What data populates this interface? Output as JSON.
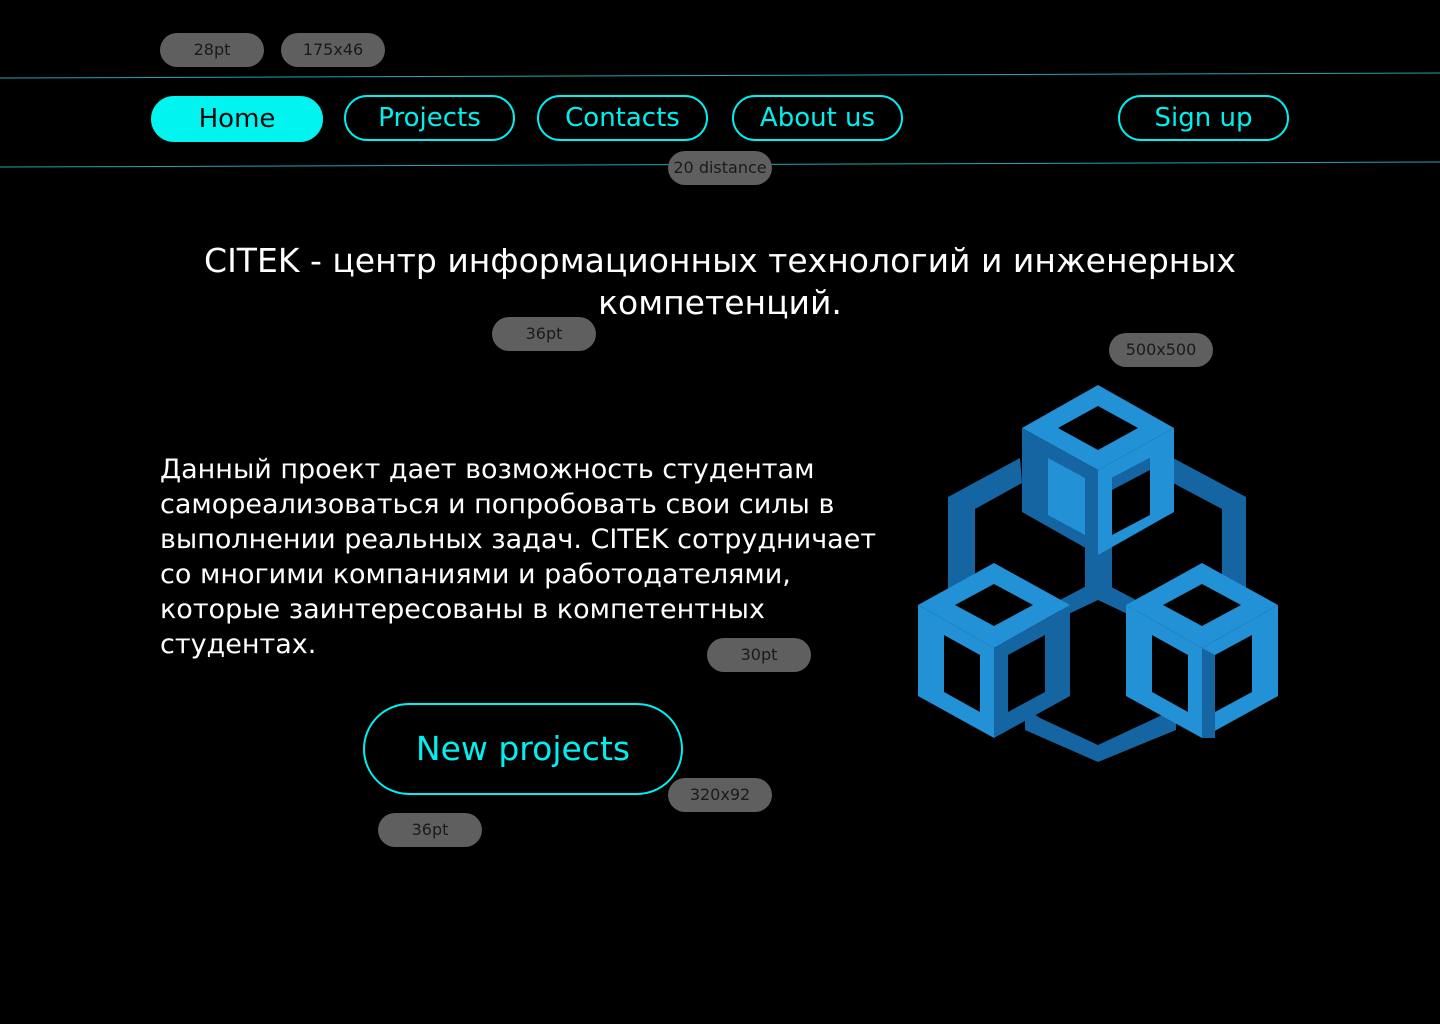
{
  "annotations": {
    "font_nav": "28pt",
    "size_nav": "175x46",
    "nav_gap": "20 distance",
    "font_heading": "36pt",
    "size_logo": "500x500",
    "font_desc": "30pt",
    "size_cta": "320x92",
    "font_cta": "36pt"
  },
  "nav": {
    "items": [
      {
        "label": "Home",
        "active": true
      },
      {
        "label": "Projects",
        "active": false
      },
      {
        "label": "Contacts",
        "active": false
      },
      {
        "label": "About us",
        "active": false
      }
    ],
    "signup_label": "Sign up"
  },
  "hero": {
    "heading": "CITEK - центр информационных технологий и инженерных компетенций.",
    "description": "Данный проект дает возможность студентам самореализоваться и попробовать свои силы в выполнении реальных задач. CITEK сотрудничает со многими компаниями и работодателями, которые заинтересованы в компетентных студентах.",
    "cta_label": "New projects"
  },
  "logo": {
    "icon": "three-cubes-logo-icon"
  },
  "colors": {
    "background": "#000000",
    "accent": "#00f0f0",
    "line": "#1fa8b0",
    "annotation": "#5f5f5f",
    "cube_light": "#2291d6",
    "cube_dark": "#1565a3"
  }
}
